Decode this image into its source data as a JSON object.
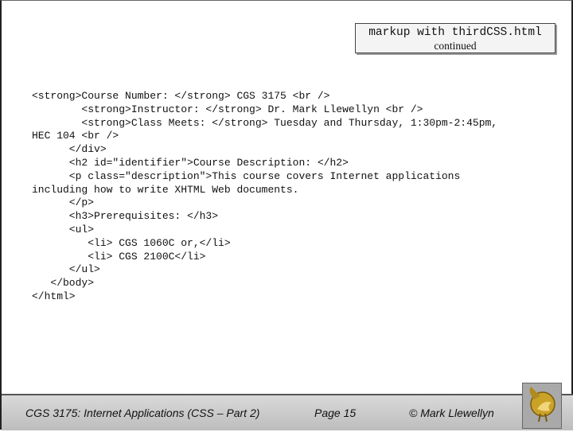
{
  "title": {
    "main": "markup with thirdCSS.html",
    "sub": "continued"
  },
  "code_lines": [
    "<strong>Course Number: </strong> CGS 3175 <br />",
    "        <strong>Instructor: </strong> Dr. Mark Llewellyn <br />",
    "        <strong>Class Meets: </strong> Tuesday and Thursday, 1:30pm-2:45pm,",
    "HEC 104 <br />",
    "      </div>",
    "      <h2 id=\"identifier\">Course Description: </h2>",
    "      <p class=\"description\">This course covers Internet applications",
    "including how to write XHTML Web documents.",
    "      </p>",
    "      <h3>Prerequisites: </h3>",
    "      <ul>",
    "         <li> CGS 1060C or,</li>",
    "         <li> CGS 2100C</li>",
    "      </ul>",
    "   </body>",
    "</html>"
  ],
  "footer": {
    "course": "CGS 3175: Internet Applications (CSS – Part 2)",
    "page": "Page 15",
    "author": "© Mark Llewellyn"
  },
  "logo_icon": "pegasus-logo-icon",
  "colors": {
    "logo_gold": "#c9a227",
    "footer_bg": "#c8c8c8"
  }
}
